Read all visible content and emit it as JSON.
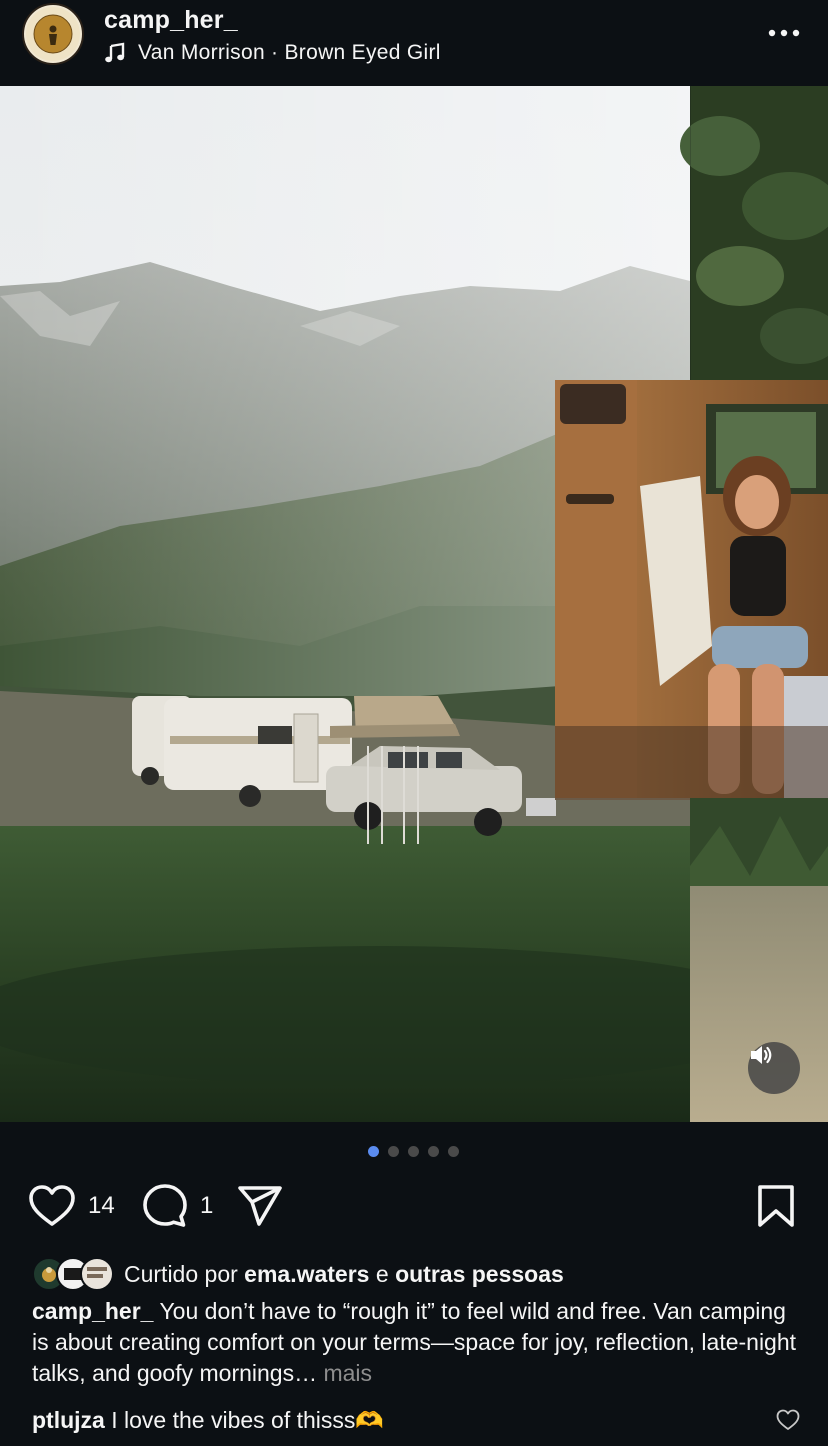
{
  "post": {
    "username": "camp_her_",
    "avatar_text": "CAMP.HER",
    "music": "Van Morrison · Brown Eyed Girl",
    "like_count": "14",
    "comment_count": "1",
    "carousel_total": 5,
    "carousel_active": 1
  },
  "liked_by": {
    "prefix": "Curtido por",
    "user": "ema.waters",
    "joiner": "e",
    "others": "outras pessoas"
  },
  "caption": {
    "username": "camp_her_",
    "text": "You don’t have to “rough it” to feel wild and free. Van camping is about creating comfort on your terms—space for joy, reflection, late-night talks, and goofy mornings…",
    "more": "mais"
  },
  "comment": {
    "username": "ptlujza",
    "text": "I love the vibes of thisss🫶"
  },
  "icons": {
    "more": "more-horizontal-icon",
    "music": "music-note-icon",
    "like": "heart-icon",
    "comment": "comment-bubble-icon",
    "share": "paper-plane-icon",
    "save": "bookmark-icon",
    "sound": "speaker-icon"
  },
  "colors": {
    "background": "#0c1014",
    "text": "#f5f5f5",
    "muted": "#8e8e8e",
    "carousel_active": "#5b8cf0"
  }
}
